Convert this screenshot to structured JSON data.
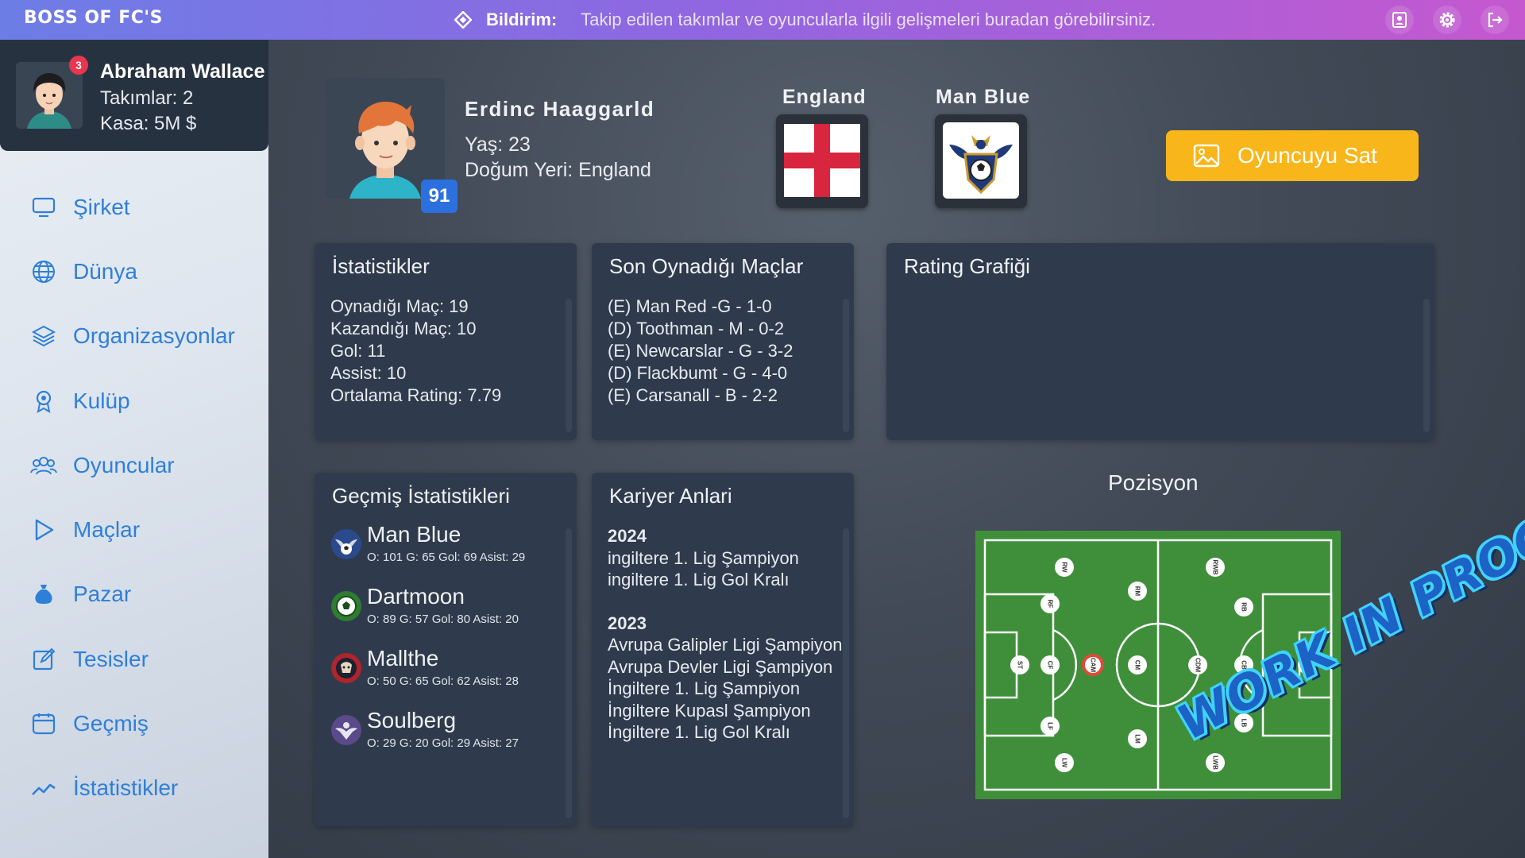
{
  "app": {
    "title": "BOSS OF FC'S"
  },
  "notification": {
    "label": "Bildirim:",
    "text": "Takip edilen takımlar ve oyuncularla ilgili gelişmeleri buradan görebilirsiniz.",
    "icon": "diamond-icon"
  },
  "top_icons": [
    "contacts-icon",
    "gear-icon",
    "logout-icon"
  ],
  "user": {
    "name": "Abraham Wallace",
    "teams": "Takımlar: 2",
    "cash": "Kasa: 5M $",
    "notification_count": "3"
  },
  "sidebar": {
    "items": [
      {
        "label": "Şirket",
        "icon": "monitor-icon"
      },
      {
        "label": "Dünya",
        "icon": "globe-icon"
      },
      {
        "label": "Organizasyonlar",
        "icon": "layers-icon"
      },
      {
        "label": "Kulüp",
        "icon": "award-icon"
      },
      {
        "label": "Oyuncular",
        "icon": "users-icon"
      },
      {
        "label": "Maçlar",
        "icon": "play-icon"
      },
      {
        "label": "Pazar",
        "icon": "money-bag-icon"
      },
      {
        "label": "Tesisler",
        "icon": "edit-icon"
      },
      {
        "label": "Geçmiş",
        "icon": "calendar-icon"
      },
      {
        "label": "İstatistikler",
        "icon": "trend-icon"
      }
    ]
  },
  "player": {
    "name": "Erdinc Haaggarld",
    "age": "Yaş: 23",
    "birthplace": "Doğum Yeri: England",
    "rating": "91",
    "country": "England",
    "club": "Man Blue"
  },
  "actions": {
    "sell_label": "Oyuncuyu Sat"
  },
  "stats_panel": {
    "title": "İstatistikler",
    "lines": [
      "Oynadığı Maç: 19",
      "Kazandığı Maç: 10",
      "Gol: 11",
      "Assist: 10",
      "Ortalama Rating: 7.79"
    ]
  },
  "matches_panel": {
    "title": "Son Oynadığı Maçlar",
    "lines": [
      "(E) Man Red -G - 1-0",
      "(D) Toothman - M - 0-2",
      "(E) Newcarslar - G - 3-2",
      "(D) Flackbumt - G - 4-0",
      "(E) Carsanall - B - 2-2"
    ]
  },
  "rating_panel": {
    "title": "Rating Grafiği"
  },
  "history_panel": {
    "title": "Geçmiş İstatistikleri",
    "items": [
      {
        "club": "Man Blue",
        "stats": "O: 101 G: 65 Gol: 69 Asist: 29",
        "color": "#2b4a8c"
      },
      {
        "club": "Dartmoon",
        "stats": "O: 89 G: 57 Gol: 80 Asist: 20",
        "color": "#2e7d32"
      },
      {
        "club": "Mallthe",
        "stats": "O: 50 G: 65 Gol: 62 Asist: 28",
        "color": "#b0242c"
      },
      {
        "club": "Soulberg",
        "stats": "O: 29 G: 20 Gol: 29 Asist: 27",
        "color": "#5a4a8a"
      }
    ]
  },
  "career_panel": {
    "title": "Kariyer Anlari",
    "years": [
      {
        "year": "2024",
        "items": [
          "ingiltere 1. Lig Şampiyon",
          "ingiltere 1. Lig Gol Kralı"
        ]
      },
      {
        "year": "2023",
        "items": [
          "Avrupa Galipler Ligi Şampiyon",
          "Avrupa Devler Ligi Şampiyon",
          "İngiltere 1. Lig Şampiyon",
          "İngiltere Kupasl Şampiyon",
          "İngiltere 1. Lig Gol Kralı"
        ]
      }
    ]
  },
  "position": {
    "title": "Pozisyon",
    "selected": "CAM",
    "labels": [
      "RW",
      "RWB",
      "RF",
      "RM",
      "RB",
      "ST",
      "CF",
      "CAM",
      "CM",
      "CDM",
      "CB",
      "GK",
      "LF",
      "LM",
      "LB",
      "LW",
      "LWB"
    ],
    "colors": {
      "pitch": "#3f8f3a",
      "border": "#7fbf4a",
      "selected": "#e04a3a"
    }
  },
  "watermark": "WORK IN PROGRESS",
  "colors": {
    "accent": "#2f7fd8",
    "sell": "#f8b61a",
    "rating_badge": "#2c70df",
    "panel": "#2f3b4c"
  }
}
